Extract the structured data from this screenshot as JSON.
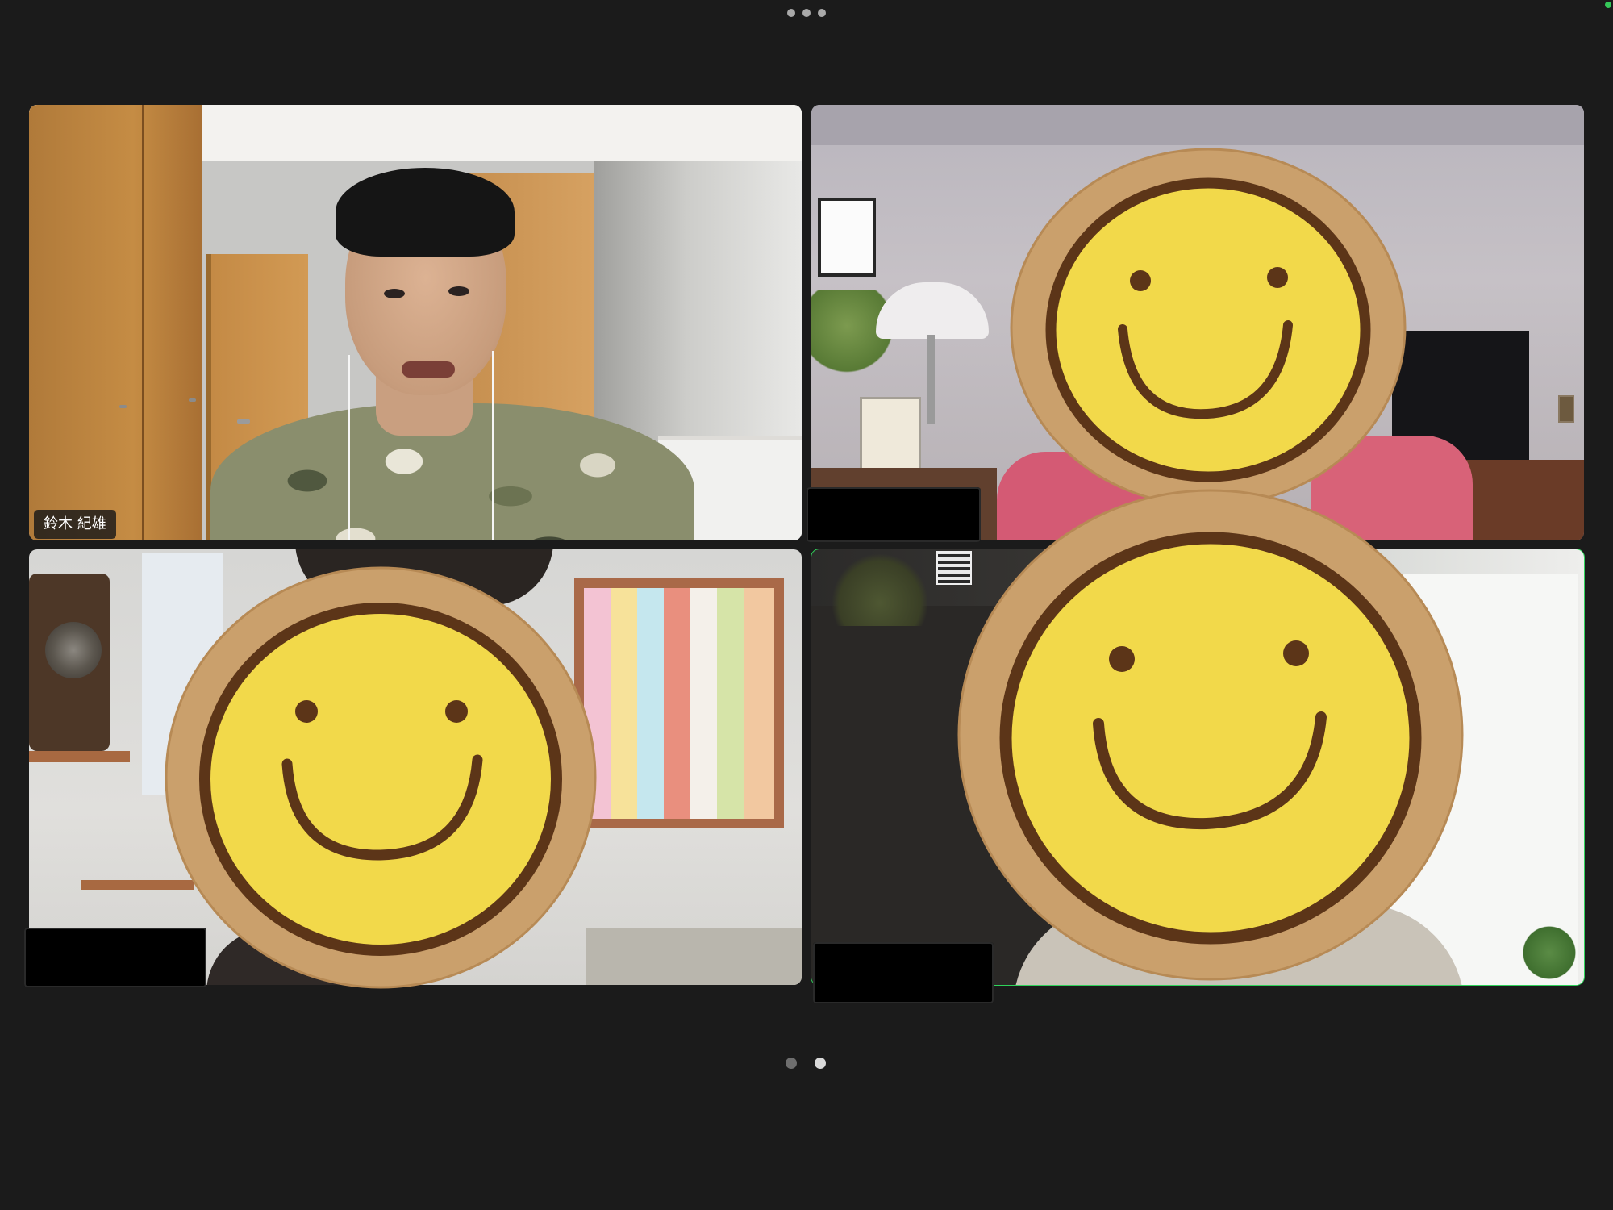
{
  "meeting": {
    "more_menu_icon": "more-horizontal-icon",
    "layout": "gallery-2x2",
    "active_speaker_border_color": "#2fd35a"
  },
  "participants": [
    {
      "name": "鈴木 紀雄",
      "avatar": "camera-video",
      "active_speaker": false
    },
    {
      "name": "",
      "name_hidden": true,
      "avatar": "smiley-face-cover",
      "active_speaker": false
    },
    {
      "name": "",
      "name_hidden": true,
      "avatar": "smiley-face-cover",
      "active_speaker": false
    },
    {
      "name": "",
      "name_hidden": true,
      "avatar": "smiley-face-cover",
      "active_speaker": true
    }
  ],
  "pagination": {
    "total_pages": 2,
    "current_page": 2,
    "dot_color_active": "#d9d9d9",
    "dot_color_inactive": "#6e6e6e"
  },
  "colors": {
    "background": "#1b1b1b",
    "smiley_face": "#f2d94a",
    "smiley_outline": "#5c3518",
    "smiley_wood": "#caa06c",
    "redaction": "#000000"
  }
}
